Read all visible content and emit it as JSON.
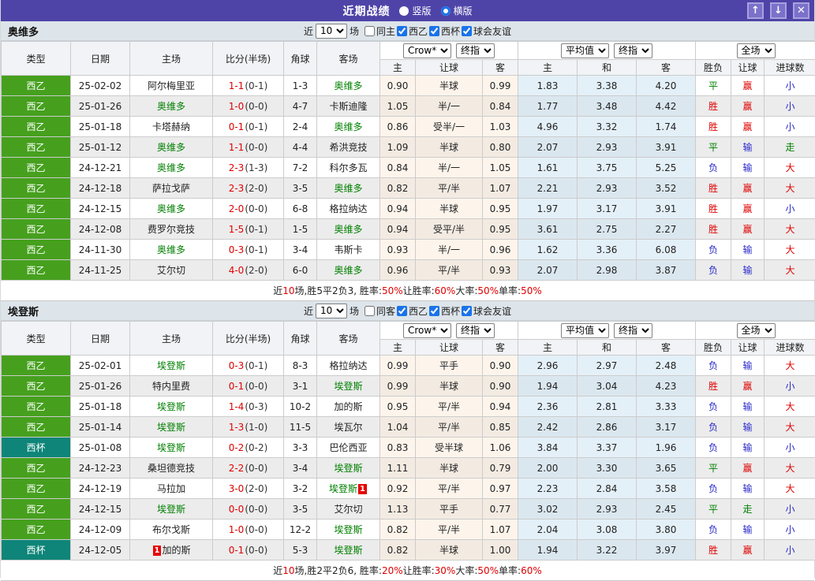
{
  "palette": {
    "bar": "#4e44a8",
    "btn": "#7b71ca",
    "btn_border": "#a9a1de",
    "accent_blue": "#1a73e8",
    "filter_bg": "#dde4ea",
    "head_bg": "#f1f3f6",
    "border": "#cccccc",
    "red": "#e00000",
    "green": "#008000",
    "blue": "#2929c8",
    "lg_green": "#46a01e",
    "lg_teal": "#0e8578",
    "od1": "#fdf5ec",
    "od2": "#f3ebe2",
    "av1": "#e4f0f8",
    "av2": "#dbe7ef"
  },
  "titlebar": {
    "title": "近期战绩",
    "vertical_label": "竖版",
    "horizontal_label": "横版",
    "up_icon": "↑",
    "down_icon": "↓",
    "close_icon": "✕"
  },
  "labels": {
    "near": "近",
    "count": "10",
    "matches": "场",
    "leagues": [
      "西乙",
      "西杯",
      "球会友谊"
    ]
  },
  "dropdowns": {
    "company": "Crow*",
    "final": "终指",
    "average": "平均值",
    "scope": "全场"
  },
  "headers": {
    "type": "类型",
    "date": "日期",
    "home": "主场",
    "score": "比分(半场)",
    "corner": "角球",
    "away": "客场",
    "h": "主",
    "hcap": "让球",
    "a": "客",
    "avg_h": "主",
    "avg_d": "和",
    "avg_a": "客",
    "wl": "胜负",
    "wl_hcap": "让球",
    "goals": "进球数"
  },
  "sections": [
    {
      "team": "奥维多",
      "filter": {
        "same": "同主"
      },
      "rows": [
        {
          "league": "西乙",
          "league_style": "green",
          "date": "25-02-02",
          "home": {
            "name": "阿尔梅里亚"
          },
          "score_ft": "1-1",
          "score_ht": "0-1",
          "corners": "1-3",
          "away": {
            "name": "奥维多",
            "is_self": true
          },
          "odds": [
            "0.90",
            "半球",
            "0.99"
          ],
          "avg": [
            "1.83",
            "3.38",
            "4.20"
          ],
          "results": [
            {
              "text": "平",
              "color": "green"
            },
            {
              "text": "赢",
              "color": "red"
            },
            {
              "text": "小",
              "color": "blue"
            }
          ]
        },
        {
          "league": "西乙",
          "league_style": "green",
          "date": "25-01-26",
          "home": {
            "name": "奥维多",
            "is_self": true
          },
          "score_ft": "1-0",
          "score_ht": "0-0",
          "corners": "4-7",
          "away": {
            "name": "卡斯迪隆"
          },
          "odds": [
            "1.05",
            "半/一",
            "0.84"
          ],
          "avg": [
            "1.77",
            "3.48",
            "4.42"
          ],
          "results": [
            {
              "text": "胜",
              "color": "red"
            },
            {
              "text": "赢",
              "color": "red"
            },
            {
              "text": "小",
              "color": "blue"
            }
          ]
        },
        {
          "league": "西乙",
          "league_style": "green",
          "date": "25-01-18",
          "home": {
            "name": "卡塔赫纳"
          },
          "score_ft": "0-1",
          "score_ht": "0-1",
          "corners": "2-4",
          "away": {
            "name": "奥维多",
            "is_self": true
          },
          "odds": [
            "0.86",
            "受半/一",
            "1.03"
          ],
          "avg": [
            "4.96",
            "3.32",
            "1.74"
          ],
          "results": [
            {
              "text": "胜",
              "color": "red"
            },
            {
              "text": "赢",
              "color": "red"
            },
            {
              "text": "小",
              "color": "blue"
            }
          ]
        },
        {
          "league": "西乙",
          "league_style": "green",
          "date": "25-01-12",
          "home": {
            "name": "奥维多",
            "is_self": true
          },
          "score_ft": "1-1",
          "score_ht": "0-0",
          "corners": "4-4",
          "away": {
            "name": "希洪竞技"
          },
          "odds": [
            "1.09",
            "半球",
            "0.80"
          ],
          "avg": [
            "2.07",
            "2.93",
            "3.91"
          ],
          "results": [
            {
              "text": "平",
              "color": "green"
            },
            {
              "text": "输",
              "color": "blue"
            },
            {
              "text": "走",
              "color": "green"
            }
          ]
        },
        {
          "league": "西乙",
          "league_style": "green",
          "date": "24-12-21",
          "home": {
            "name": "奥维多",
            "is_self": true
          },
          "score_ft": "2-3",
          "score_ht": "1-3",
          "corners": "7-2",
          "away": {
            "name": "科尔多瓦"
          },
          "odds": [
            "0.84",
            "半/一",
            "1.05"
          ],
          "avg": [
            "1.61",
            "3.75",
            "5.25"
          ],
          "results": [
            {
              "text": "负",
              "color": "blue"
            },
            {
              "text": "输",
              "color": "blue"
            },
            {
              "text": "大",
              "color": "red"
            }
          ]
        },
        {
          "league": "西乙",
          "league_style": "green",
          "date": "24-12-18",
          "home": {
            "name": "萨拉戈萨"
          },
          "score_ft": "2-3",
          "score_ht": "2-0",
          "corners": "3-5",
          "away": {
            "name": "奥维多",
            "is_self": true
          },
          "odds": [
            "0.82",
            "平/半",
            "1.07"
          ],
          "avg": [
            "2.21",
            "2.93",
            "3.52"
          ],
          "results": [
            {
              "text": "胜",
              "color": "red"
            },
            {
              "text": "赢",
              "color": "red"
            },
            {
              "text": "大",
              "color": "red"
            }
          ]
        },
        {
          "league": "西乙",
          "league_style": "green",
          "date": "24-12-15",
          "home": {
            "name": "奥维多",
            "is_self": true
          },
          "score_ft": "2-0",
          "score_ht": "0-0",
          "corners": "6-8",
          "away": {
            "name": "格拉纳达"
          },
          "odds": [
            "0.94",
            "半球",
            "0.95"
          ],
          "avg": [
            "1.97",
            "3.17",
            "3.91"
          ],
          "results": [
            {
              "text": "胜",
              "color": "red"
            },
            {
              "text": "赢",
              "color": "red"
            },
            {
              "text": "小",
              "color": "blue"
            }
          ]
        },
        {
          "league": "西乙",
          "league_style": "green",
          "date": "24-12-08",
          "home": {
            "name": "费罗尔竞技"
          },
          "score_ft": "1-5",
          "score_ht": "0-1",
          "corners": "1-5",
          "away": {
            "name": "奥维多",
            "is_self": true
          },
          "odds": [
            "0.94",
            "受平/半",
            "0.95"
          ],
          "avg": [
            "3.61",
            "2.75",
            "2.27"
          ],
          "results": [
            {
              "text": "胜",
              "color": "red"
            },
            {
              "text": "赢",
              "color": "red"
            },
            {
              "text": "大",
              "color": "red"
            }
          ]
        },
        {
          "league": "西乙",
          "league_style": "green",
          "date": "24-11-30",
          "home": {
            "name": "奥维多",
            "is_self": true
          },
          "score_ft": "0-3",
          "score_ht": "0-1",
          "corners": "3-4",
          "away": {
            "name": "韦斯卡"
          },
          "odds": [
            "0.93",
            "半/一",
            "0.96"
          ],
          "avg": [
            "1.62",
            "3.36",
            "6.08"
          ],
          "results": [
            {
              "text": "负",
              "color": "blue"
            },
            {
              "text": "输",
              "color": "blue"
            },
            {
              "text": "大",
              "color": "red"
            }
          ]
        },
        {
          "league": "西乙",
          "league_style": "green",
          "date": "24-11-25",
          "home": {
            "name": "艾尔切"
          },
          "score_ft": "4-0",
          "score_ht": "2-0",
          "corners": "6-0",
          "away": {
            "name": "奥维多",
            "is_self": true
          },
          "odds": [
            "0.96",
            "平/半",
            "0.93"
          ],
          "avg": [
            "2.07",
            "2.98",
            "3.87"
          ],
          "results": [
            {
              "text": "负",
              "color": "blue"
            },
            {
              "text": "输",
              "color": "blue"
            },
            {
              "text": "大",
              "color": "red"
            }
          ]
        }
      ],
      "summary": [
        {
          "text": "近"
        },
        {
          "text": "10",
          "color": "red"
        },
        {
          "text": "场,胜5平2负3, 胜率:"
        },
        {
          "text": "50%",
          "color": "red"
        },
        {
          "text": " 让胜率:"
        },
        {
          "text": "60%",
          "color": "red"
        },
        {
          "text": " 大率:"
        },
        {
          "text": "50%",
          "color": "red"
        },
        {
          "text": " 单率:"
        },
        {
          "text": "50%",
          "color": "red"
        }
      ]
    },
    {
      "team": "埃登斯",
      "filter": {
        "same": "同客"
      },
      "rows": [
        {
          "league": "西乙",
          "league_style": "green",
          "date": "25-02-01",
          "home": {
            "name": "埃登斯",
            "is_self": true
          },
          "score_ft": "0-3",
          "score_ht": "0-1",
          "corners": "8-3",
          "away": {
            "name": "格拉纳达"
          },
          "odds": [
            "0.99",
            "平手",
            "0.90"
          ],
          "avg": [
            "2.96",
            "2.97",
            "2.48"
          ],
          "results": [
            {
              "text": "负",
              "color": "blue"
            },
            {
              "text": "输",
              "color": "blue"
            },
            {
              "text": "大",
              "color": "red"
            }
          ]
        },
        {
          "league": "西乙",
          "league_style": "green",
          "date": "25-01-26",
          "home": {
            "name": "特内里费"
          },
          "score_ft": "0-1",
          "score_ht": "0-0",
          "corners": "3-1",
          "away": {
            "name": "埃登斯",
            "is_self": true
          },
          "odds": [
            "0.99",
            "半球",
            "0.90"
          ],
          "avg": [
            "1.94",
            "3.04",
            "4.23"
          ],
          "results": [
            {
              "text": "胜",
              "color": "red"
            },
            {
              "text": "赢",
              "color": "red"
            },
            {
              "text": "小",
              "color": "blue"
            }
          ]
        },
        {
          "league": "西乙",
          "league_style": "green",
          "date": "25-01-18",
          "home": {
            "name": "埃登斯",
            "is_self": true
          },
          "score_ft": "1-4",
          "score_ht": "0-3",
          "corners": "10-2",
          "away": {
            "name": "加的斯"
          },
          "odds": [
            "0.95",
            "平/半",
            "0.94"
          ],
          "avg": [
            "2.36",
            "2.81",
            "3.33"
          ],
          "results": [
            {
              "text": "负",
              "color": "blue"
            },
            {
              "text": "输",
              "color": "blue"
            },
            {
              "text": "大",
              "color": "red"
            }
          ]
        },
        {
          "league": "西乙",
          "league_style": "green",
          "date": "25-01-14",
          "home": {
            "name": "埃登斯",
            "is_self": true
          },
          "score_ft": "1-3",
          "score_ht": "1-0",
          "corners": "11-5",
          "away": {
            "name": "埃瓦尔"
          },
          "odds": [
            "1.04",
            "平/半",
            "0.85"
          ],
          "avg": [
            "2.42",
            "2.86",
            "3.17"
          ],
          "results": [
            {
              "text": "负",
              "color": "blue"
            },
            {
              "text": "输",
              "color": "blue"
            },
            {
              "text": "大",
              "color": "red"
            }
          ]
        },
        {
          "league": "西杯",
          "league_style": "teal",
          "date": "25-01-08",
          "home": {
            "name": "埃登斯",
            "is_self": true
          },
          "score_ft": "0-2",
          "score_ht": "0-2",
          "corners": "3-3",
          "away": {
            "name": "巴伦西亚"
          },
          "odds": [
            "0.83",
            "受半球",
            "1.06"
          ],
          "avg": [
            "3.84",
            "3.37",
            "1.96"
          ],
          "results": [
            {
              "text": "负",
              "color": "blue"
            },
            {
              "text": "输",
              "color": "blue"
            },
            {
              "text": "小",
              "color": "blue"
            }
          ]
        },
        {
          "league": "西乙",
          "league_style": "green",
          "date": "24-12-23",
          "home": {
            "name": "桑坦德竞技"
          },
          "score_ft": "2-2",
          "score_ht": "0-0",
          "corners": "3-4",
          "away": {
            "name": "埃登斯",
            "is_self": true
          },
          "odds": [
            "1.11",
            "半球",
            "0.79"
          ],
          "avg": [
            "2.00",
            "3.30",
            "3.65"
          ],
          "results": [
            {
              "text": "平",
              "color": "green"
            },
            {
              "text": "赢",
              "color": "red"
            },
            {
              "text": "大",
              "color": "red"
            }
          ]
        },
        {
          "league": "西乙",
          "league_style": "green",
          "date": "24-12-19",
          "home": {
            "name": "马拉加"
          },
          "score_ft": "3-0",
          "score_ht": "2-0",
          "corners": "3-2",
          "away": {
            "name": "埃登斯",
            "is_self": true,
            "badge": "1",
            "badge_pos": "after"
          },
          "odds": [
            "0.92",
            "平/半",
            "0.97"
          ],
          "avg": [
            "2.23",
            "2.84",
            "3.58"
          ],
          "results": [
            {
              "text": "负",
              "color": "blue"
            },
            {
              "text": "输",
              "color": "blue"
            },
            {
              "text": "大",
              "color": "red"
            }
          ]
        },
        {
          "league": "西乙",
          "league_style": "green",
          "date": "24-12-15",
          "home": {
            "name": "埃登斯",
            "is_self": true
          },
          "score_ft": "0-0",
          "score_ht": "0-0",
          "corners": "3-5",
          "away": {
            "name": "艾尔切"
          },
          "odds": [
            "1.13",
            "平手",
            "0.77"
          ],
          "avg": [
            "3.02",
            "2.93",
            "2.45"
          ],
          "results": [
            {
              "text": "平",
              "color": "green"
            },
            {
              "text": "走",
              "color": "green"
            },
            {
              "text": "小",
              "color": "blue"
            }
          ]
        },
        {
          "league": "西乙",
          "league_style": "green",
          "date": "24-12-09",
          "home": {
            "name": "布尔戈斯"
          },
          "score_ft": "1-0",
          "score_ht": "0-0",
          "corners": "12-2",
          "away": {
            "name": "埃登斯",
            "is_self": true
          },
          "odds": [
            "0.82",
            "平/半",
            "1.07"
          ],
          "avg": [
            "2.04",
            "3.08",
            "3.80"
          ],
          "results": [
            {
              "text": "负",
              "color": "blue"
            },
            {
              "text": "输",
              "color": "blue"
            },
            {
              "text": "小",
              "color": "blue"
            }
          ]
        },
        {
          "league": "西杯",
          "league_style": "teal",
          "date": "24-12-05",
          "home": {
            "name": "加的斯",
            "badge": "1",
            "badge_pos": "before"
          },
          "score_ft": "0-1",
          "score_ht": "0-0",
          "corners": "5-3",
          "away": {
            "name": "埃登斯",
            "is_self": true
          },
          "odds": [
            "0.82",
            "半球",
            "1.00"
          ],
          "avg": [
            "1.94",
            "3.22",
            "3.97"
          ],
          "results": [
            {
              "text": "胜",
              "color": "red"
            },
            {
              "text": "赢",
              "color": "red"
            },
            {
              "text": "小",
              "color": "blue"
            }
          ]
        }
      ],
      "summary": [
        {
          "text": "近"
        },
        {
          "text": "10",
          "color": "red"
        },
        {
          "text": "场,胜2平2负6, 胜率:"
        },
        {
          "text": "20%",
          "color": "red"
        },
        {
          "text": " 让胜率:"
        },
        {
          "text": "30%",
          "color": "red"
        },
        {
          "text": " 大率:"
        },
        {
          "text": "50%",
          "color": "red"
        },
        {
          "text": " 单率:"
        },
        {
          "text": "60%",
          "color": "red"
        }
      ]
    }
  ]
}
